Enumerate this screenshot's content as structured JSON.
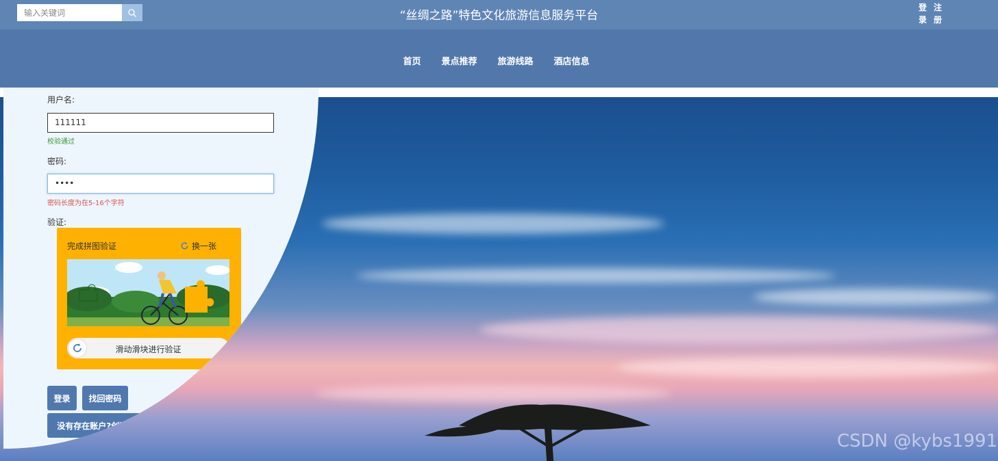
{
  "header": {
    "search_placeholder": "输入关键词",
    "site_title": "“丝绸之路”特色文化旅游信息服务平台",
    "auth": {
      "login_chars": [
        "登",
        "录"
      ],
      "register_chars": [
        "注",
        "册"
      ]
    }
  },
  "nav": {
    "items": [
      {
        "label": "首页"
      },
      {
        "label": "景点推荐"
      },
      {
        "label": "旅游线路"
      },
      {
        "label": "酒店信息"
      }
    ]
  },
  "login_form": {
    "username_label": "用户名:",
    "username_value": "111111",
    "username_status": "校验通过",
    "password_label": "密码:",
    "password_value": "••••",
    "password_error": "密码长度为在5-16个字符",
    "verify_label": "验证:",
    "captcha": {
      "title": "完成拼图验证",
      "refresh_label": "换一张",
      "slider_text": "滑动滑块进行验证"
    },
    "login_button": "登录",
    "forgot_button": "找回密码",
    "register_button": "没有存在账户?创建一个账户吧!"
  },
  "watermark": "CSDN @kybs1991",
  "colors": {
    "topbar": "#5f85b5",
    "navbar": "#5278ab",
    "button": "#4f79ae",
    "captcha": "#ffb100",
    "panel": "#eef6fd"
  }
}
